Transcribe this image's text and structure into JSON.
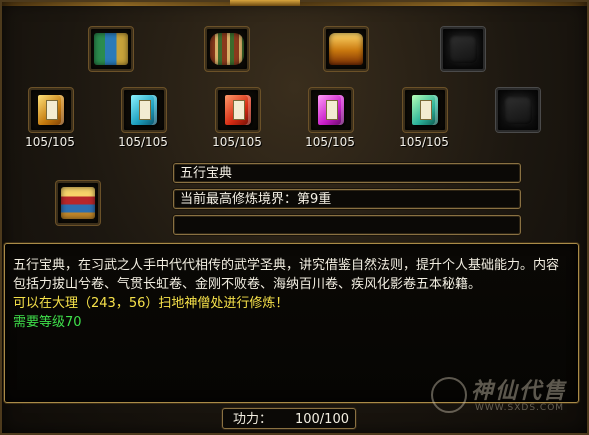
{
  "top_items": [
    {
      "icon": "books-bundle-icon"
    },
    {
      "icon": "scroll-bundle-icon"
    },
    {
      "icon": "treasure-chest-icon"
    },
    {
      "icon": "empty-slot-icon"
    }
  ],
  "manuals": [
    {
      "icon": "gold-manual-icon",
      "count": "105/105"
    },
    {
      "icon": "teal-manual-icon",
      "count": "105/105"
    },
    {
      "icon": "red-manual-icon",
      "count": "105/105"
    },
    {
      "icon": "pink-manual-icon",
      "count": "105/105"
    },
    {
      "icon": "green-manual-icon",
      "count": "105/105"
    },
    {
      "icon": "empty-slot-icon",
      "count": ""
    }
  ],
  "selected": {
    "icon": "book-stack-icon",
    "name": "五行宝典",
    "highest_realm": "当前最高修炼境界：第9重",
    "extra": ""
  },
  "description": {
    "text": "五行宝典，在习武之人手中代代相传的武学圣典，讲究借鉴自然法则，提升个人基础能力。内容包括力拔山兮卷、气贯长虹卷、金刚不败卷、海纳百川卷、疾风化影卷五本秘籍。",
    "location": "可以在大理（243，56）扫地神僧处进行修炼！",
    "requirement": "需要等级70"
  },
  "power": {
    "label": "功力：",
    "value": "100/100"
  },
  "watermark": {
    "name": "神仙代售",
    "url": "WWW.SXDS.COM"
  },
  "colors": {
    "yellow_text": "#f7e24a",
    "green_text": "#3fe04b",
    "border_gold": "#a98b48"
  }
}
